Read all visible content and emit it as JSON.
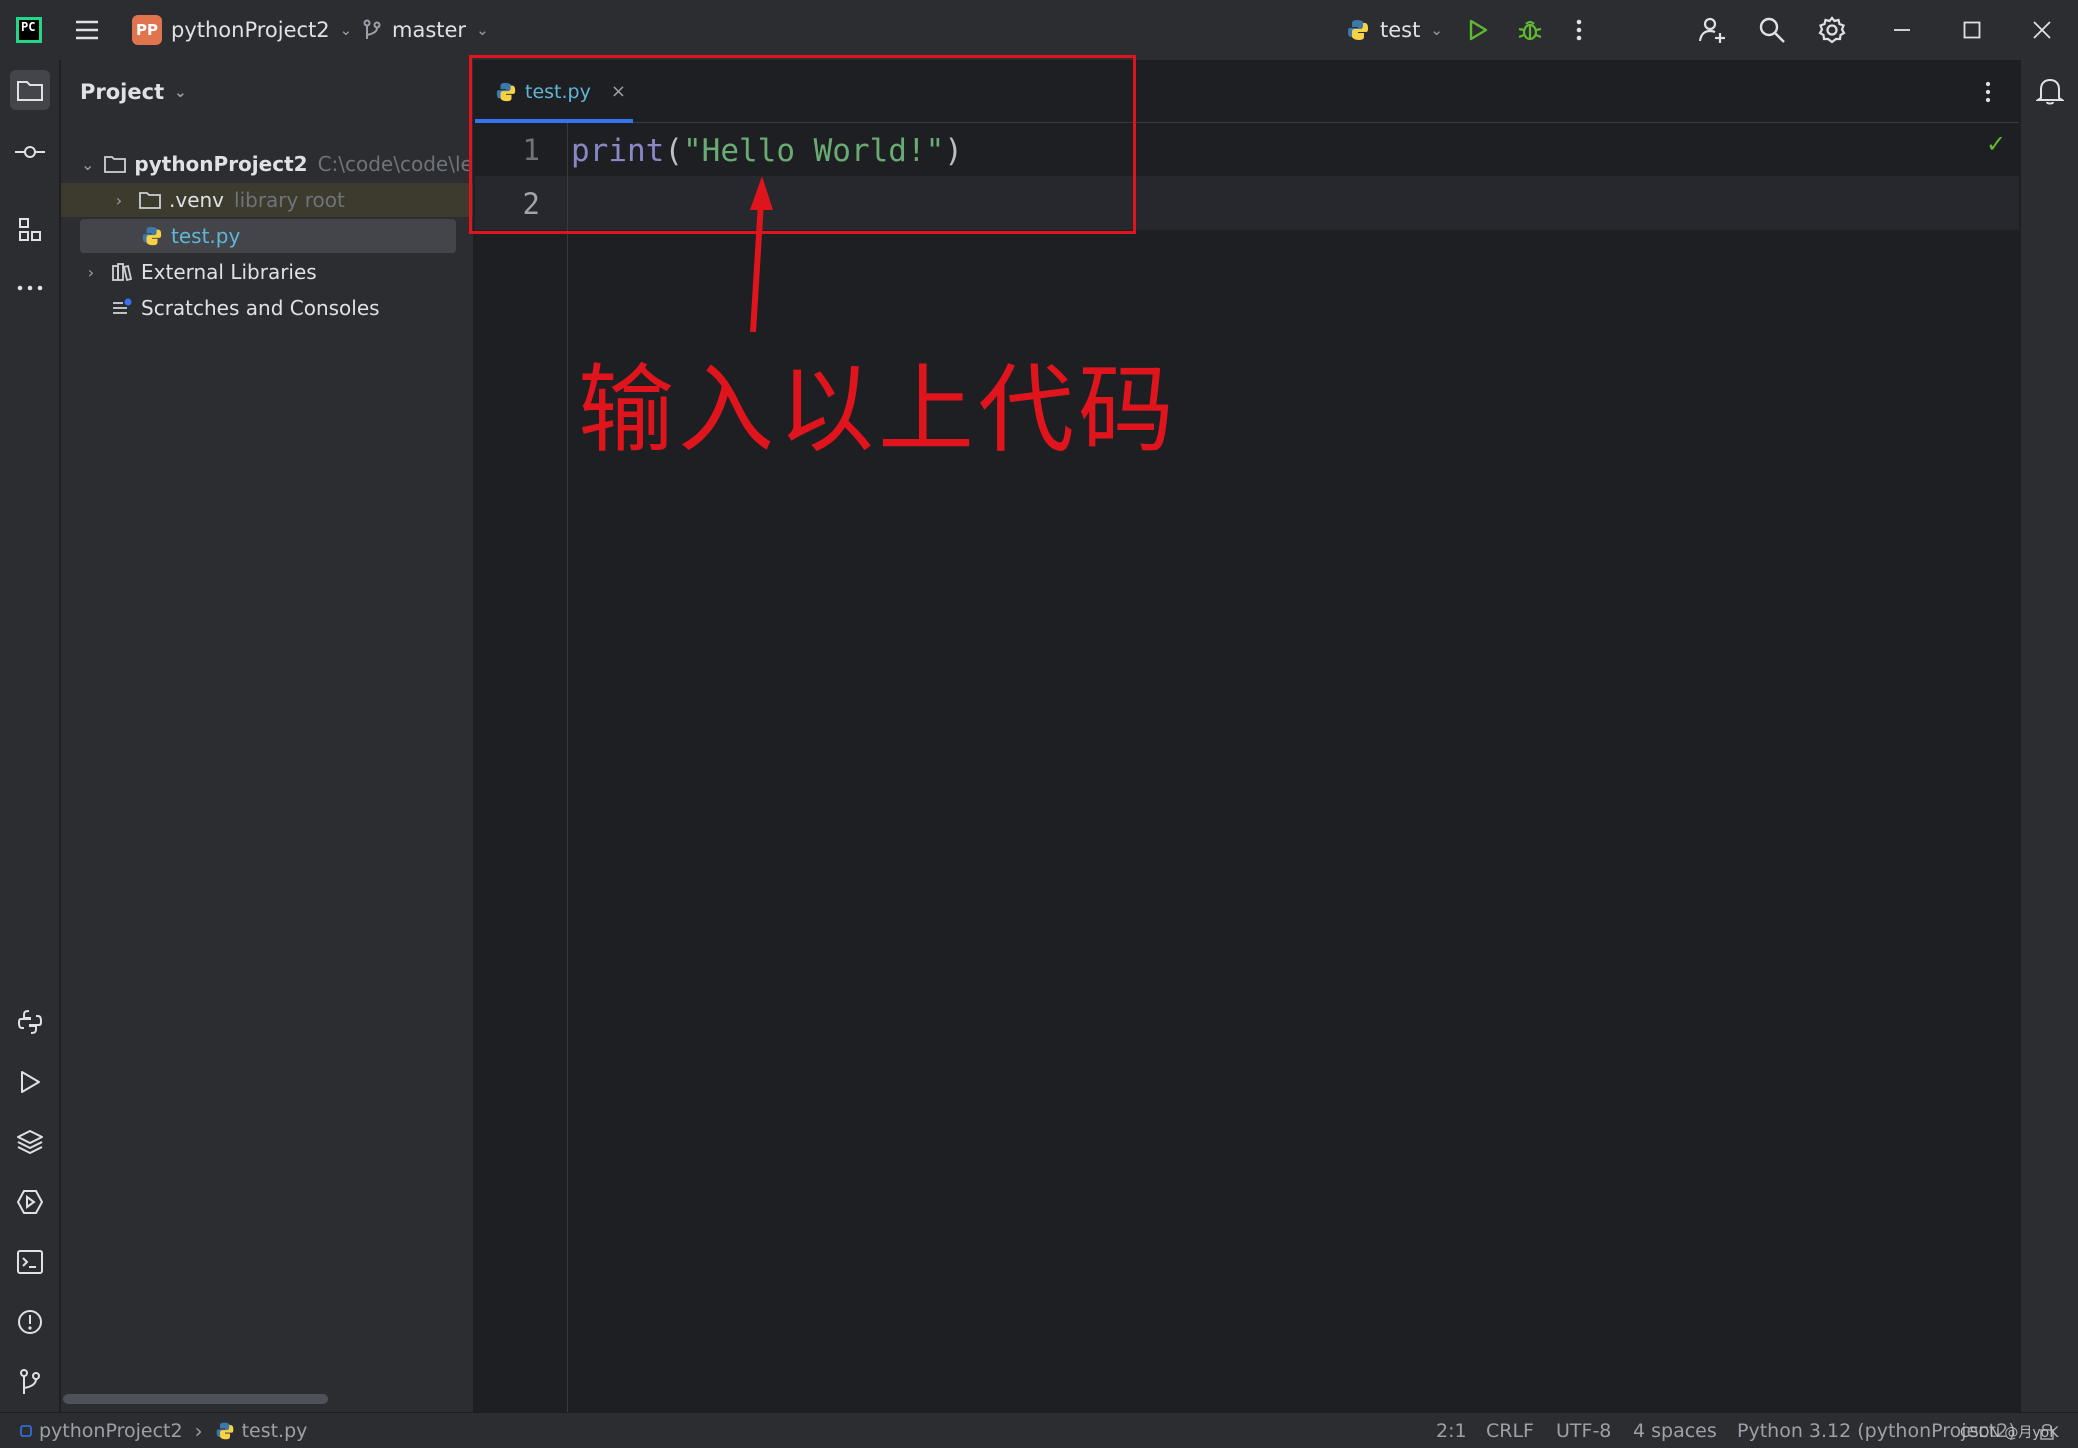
{
  "titlebar": {
    "project_badge": "PP",
    "project_name": "pythonProject2",
    "branch": "master",
    "run_config": "test"
  },
  "toolwindow": {
    "title": "Project",
    "tree": [
      {
        "label": "pythonProject2",
        "hint": "C:\\code\\code\\learn"
      },
      {
        "label": ".venv",
        "hint": "library root"
      },
      {
        "label": "test.py"
      },
      {
        "label": "External Libraries"
      },
      {
        "label": "Scratches and Consoles"
      }
    ]
  },
  "editor": {
    "tab_label": "test.py",
    "tab_close": "×",
    "line_numbers": [
      "1",
      "2"
    ],
    "code": {
      "fn": "print",
      "open": "(",
      "str": "\"Hello World!\"",
      "close": ")"
    },
    "inspection": "✓"
  },
  "statusbar": {
    "breadcrumb_project": "pythonProject2",
    "breadcrumb_file": "test.py",
    "position": "2:1",
    "line_sep": "CRLF",
    "encoding": "UTF-8",
    "indent": "4 spaces",
    "interpreter": "Python 3.12 (pythonProject2)"
  },
  "annotation": {
    "text": "输入以上代码",
    "color": "#e0141c"
  },
  "watermark": "CSDN @月yoK",
  "colors": {
    "accent": "#3574f0",
    "string": "#6aab73",
    "function": "#8888c6",
    "run_green": "#5fb832"
  }
}
